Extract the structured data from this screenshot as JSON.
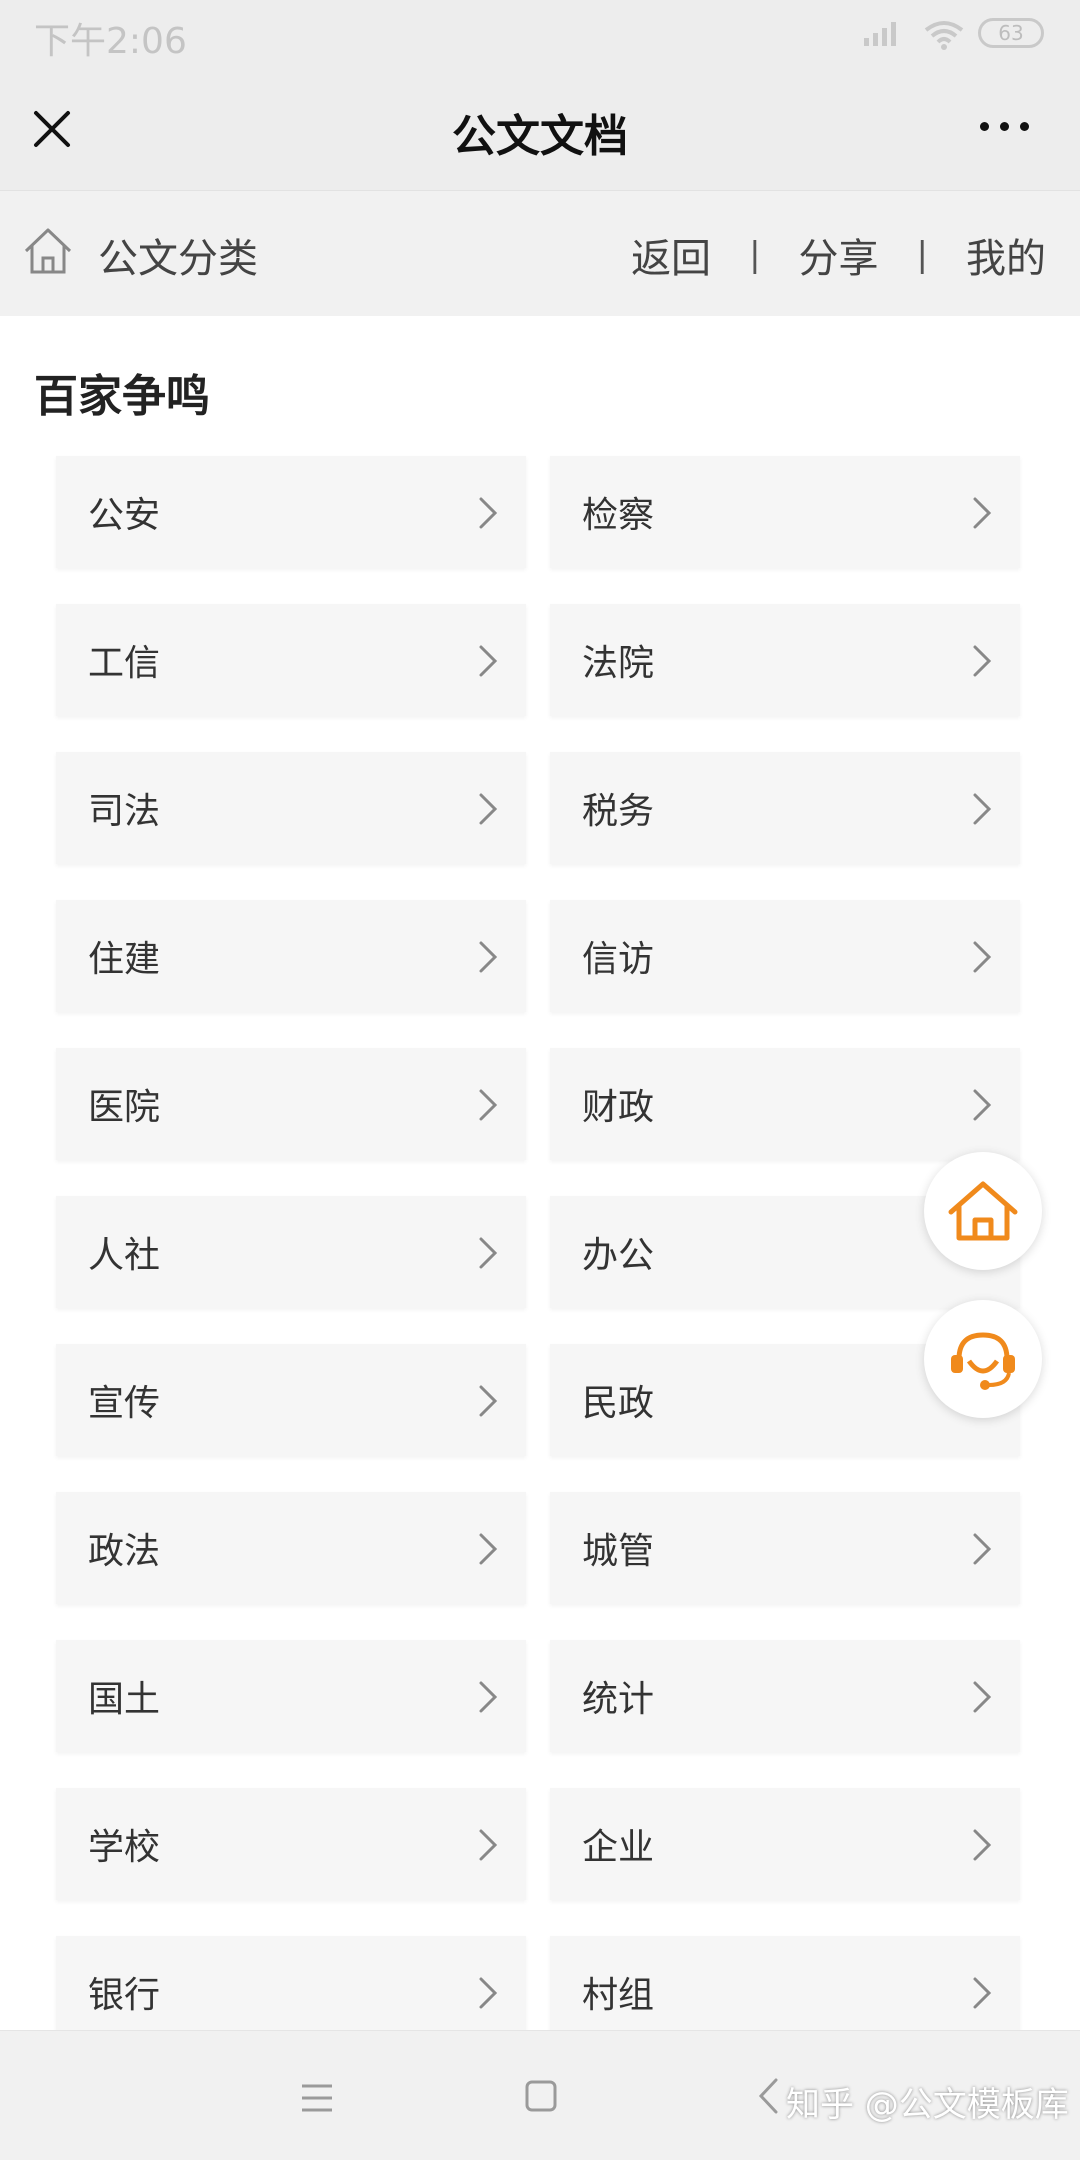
{
  "status_bar": {
    "time": "下午2:06",
    "battery": "63"
  },
  "title_bar": {
    "title": "公文文档"
  },
  "sub_nav": {
    "title": "公文分类",
    "links": [
      "返回",
      "分享",
      "我的"
    ],
    "separator": "|"
  },
  "section": {
    "title": "百家争鸣",
    "items": [
      {
        "label": "公安"
      },
      {
        "label": "检察"
      },
      {
        "label": "工信"
      },
      {
        "label": "法院"
      },
      {
        "label": "司法"
      },
      {
        "label": "税务"
      },
      {
        "label": "住建"
      },
      {
        "label": "信访"
      },
      {
        "label": "医院"
      },
      {
        "label": "财政"
      },
      {
        "label": "人社"
      },
      {
        "label": "办公"
      },
      {
        "label": "宣传"
      },
      {
        "label": "民政"
      },
      {
        "label": "政法"
      },
      {
        "label": "城管"
      },
      {
        "label": "国土"
      },
      {
        "label": "统计"
      },
      {
        "label": "学校"
      },
      {
        "label": "企业"
      },
      {
        "label": "银行"
      },
      {
        "label": "村组"
      }
    ]
  },
  "watermark": "知乎 @公文模板库",
  "colors": {
    "accent": "#f08a1c",
    "header_bg": "#ededed",
    "cell_bg": "#f6f6f6"
  },
  "icons": {
    "close": "close-icon",
    "more": "more-icon",
    "home_outline": "home-icon",
    "chevron": "chevron-right-icon",
    "fab_home": "home-icon",
    "fab_service": "headset-icon"
  }
}
